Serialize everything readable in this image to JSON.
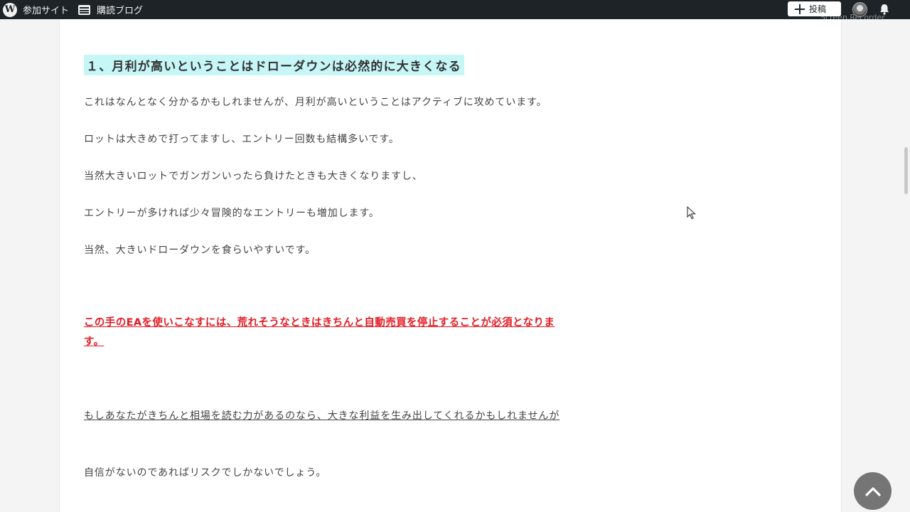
{
  "adminbar": {
    "site_label": "参加サイト",
    "reader_label": "購読ブログ",
    "post_button_label": "投稿",
    "watermark_text": "Screen Recorder"
  },
  "article": {
    "heading": "１、月利が高いということはドローダウンは必然的に大きくなる",
    "paragraphs": [
      "これはなんとなく分かるかもしれませんが、月利が高いということはアクティブに攻めています。",
      "ロットは大きめで打ってますし、エントリー回数も結構多いです。",
      "当然大きいロットでガンガンいったら負けたときも大きくなりますし、",
      "エントリーが多ければ少々冒険的なエントリーも増加します。",
      "当然、大きいドローダウンを食らいやすいです。"
    ],
    "emphasis": "この手のEAを使いこなすには、荒れそうなときはきちんと自動売買を停止することが必須となります。",
    "underlined": "もしあなたがきちんと相場を読む力があるのなら、大きな利益を生み出してくれるかもしれませんが",
    "closing": "自信がないのであればリスクでしかないでしょう。"
  },
  "icons": {
    "wp": "wordpress-logo-icon",
    "reader": "reader-icon",
    "plus": "plus-icon",
    "notifications": "bell-icon",
    "scroll_top": "chevron-up-icon"
  },
  "colors": {
    "adminbar_bg": "#1d2327",
    "heading_highlight": "#c7f6f7",
    "emphasis_red": "#e31b23",
    "to_top_bg": "#757575"
  }
}
